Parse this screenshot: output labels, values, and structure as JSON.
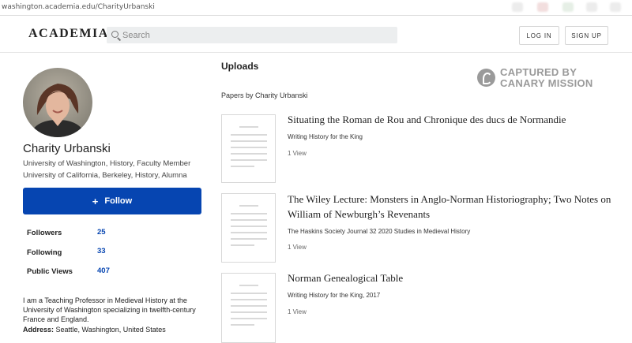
{
  "browser": {
    "url": "washington.academia.edu/CharityUrbanski"
  },
  "header": {
    "logo": "ACADEMIA",
    "search_placeholder": "Search",
    "login_label": "LOG IN",
    "signup_label": "SIGN UP"
  },
  "profile": {
    "name": "Charity Urbanski",
    "affiliations": [
      "University of Washington, History, Faculty Member",
      "University of California, Berkeley, History, Alumna"
    ],
    "follow_label": "Follow",
    "stats": [
      {
        "label": "Followers",
        "value": "25"
      },
      {
        "label": "Following",
        "value": "33"
      },
      {
        "label": "Public Views",
        "value": "407"
      }
    ],
    "bio": "I am a Teaching Professor in Medieval History at the University of Washington specializing in twelfth-century France and England.",
    "address_label": "Address:",
    "address_value": "Seattle, Washington, United States"
  },
  "main": {
    "section_title": "Uploads",
    "papers_by": "Papers by Charity Urbanski",
    "watermark": {
      "line1": "CAPTURED BY",
      "line2": "CANARY MISSION"
    },
    "papers": [
      {
        "title": "Situating the Roman de Rou and Chronique des ducs de Normandie",
        "subtitle": "Writing History for the King",
        "views": "1 View"
      },
      {
        "title": "The Wiley Lecture: Monsters in Anglo-Norman Historiography; Two Notes on William of Newburgh’s Revenants",
        "subtitle": "The Haskins Society Journal 32 2020 Studies in Medieval History",
        "views": "1 View"
      },
      {
        "title": "Norman Genealogical Table",
        "subtitle": "Writing History for the King, 2017",
        "views": "1 View"
      }
    ]
  },
  "colors": {
    "brand_blue": "#0645b1",
    "watermark_gray": "#9a9a9a"
  }
}
